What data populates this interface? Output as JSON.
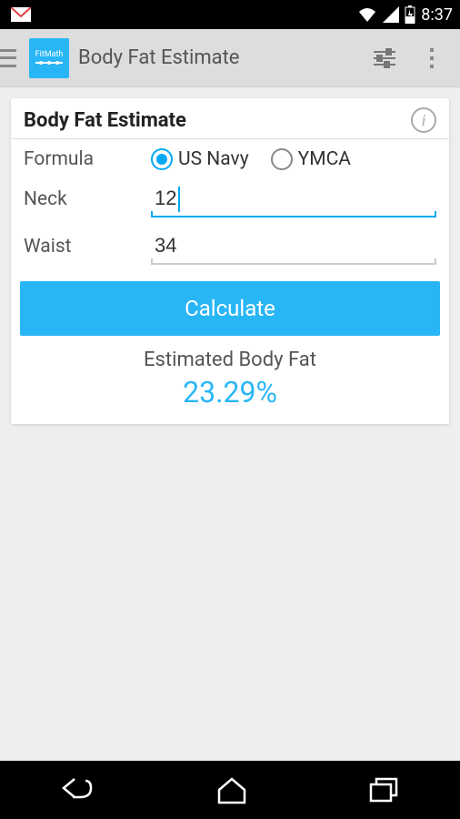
{
  "status": {
    "time": "8:37"
  },
  "header": {
    "title": "Body Fat Estimate",
    "app_icon_label": "FitMath"
  },
  "card": {
    "title": "Body Fat Estimate",
    "formula_label": "Formula",
    "formula_options": {
      "us_navy": "US Navy",
      "ymca": "YMCA"
    },
    "formula_selected": "us_navy",
    "neck_label": "Neck",
    "neck_value": "12",
    "waist_label": "Waist",
    "waist_value": "34",
    "calculate_label": "Calculate",
    "result_label": "Estimated Body Fat",
    "result_value": "23.29%"
  }
}
